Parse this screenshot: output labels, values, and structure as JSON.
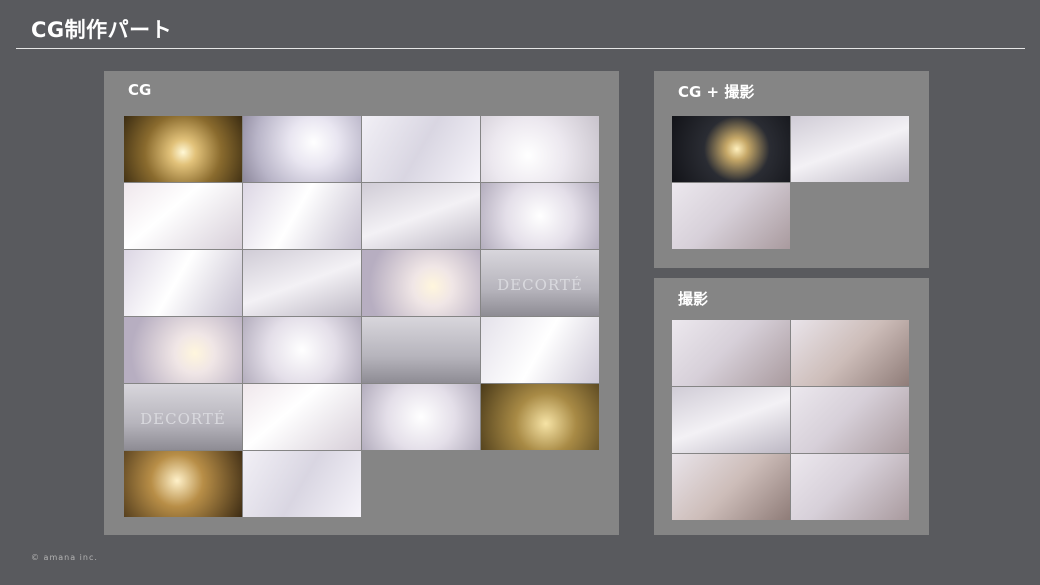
{
  "header": {
    "title": "CG制作パート"
  },
  "footer": {
    "copyright": "© amana inc."
  },
  "panels": {
    "cg": {
      "label": "CG"
    },
    "cg_shoot": {
      "label": "CG + 撮影"
    },
    "shoot": {
      "label": "撮影"
    }
  },
  "thumb_text": {
    "jar_brand": "DECORTÉ",
    "jar_brand_2": "DECORTÉ"
  }
}
